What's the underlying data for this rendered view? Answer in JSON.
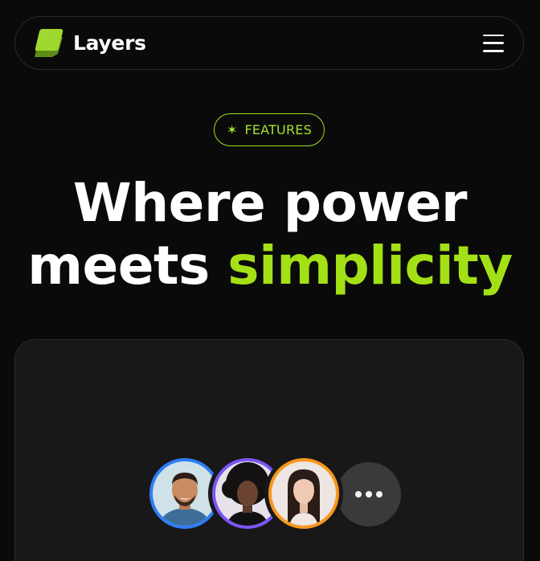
{
  "nav": {
    "brand": "Layers",
    "logo_icon": "layers-logo-icon",
    "menu_icon": "hamburger-menu-icon"
  },
  "badge": {
    "icon": "sparkle-icon",
    "label": "FEATURES"
  },
  "hero": {
    "line1": "Where power",
    "line2_plain": "meets ",
    "line2_accent": "simplicity"
  },
  "avatars": [
    {
      "name": "avatar-man-smiling",
      "ring_color": "#2f7df6"
    },
    {
      "name": "avatar-woman-curly-hair",
      "ring_color": "#7b55f5"
    },
    {
      "name": "avatar-woman-long-hair",
      "ring_color": "#f7971c"
    }
  ],
  "more_button_icon": "more-dots-icon",
  "colors": {
    "background": "#0a0a0a",
    "accent": "#a3e015",
    "card": "#181818"
  }
}
